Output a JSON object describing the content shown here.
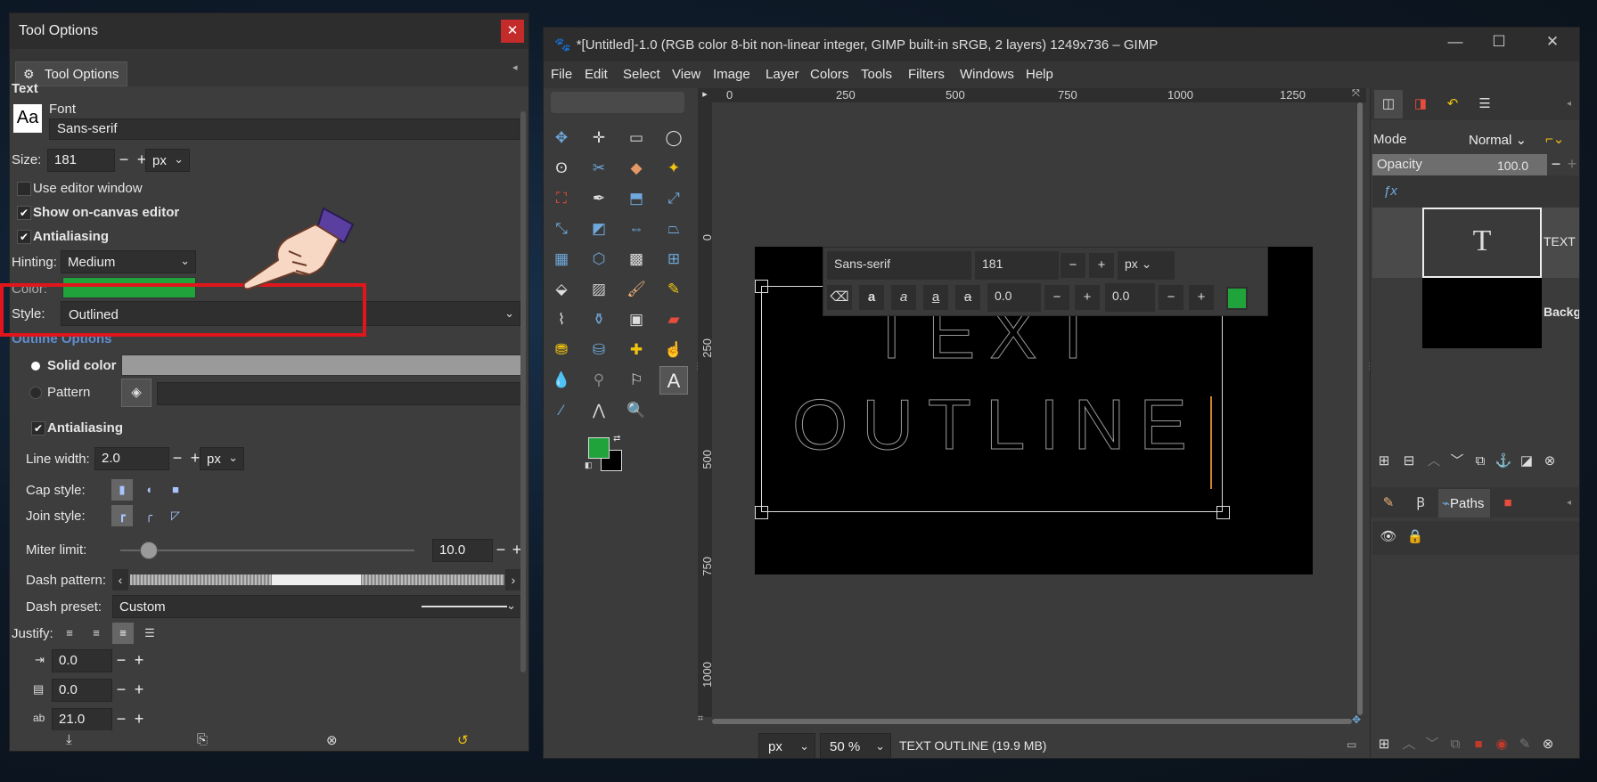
{
  "tool_options": {
    "window_title": "Tool Options",
    "tab_label": "Tool Options",
    "section_text": "Text",
    "font_label": "Font",
    "font_preview": "Aa",
    "font_value": "Sans-serif",
    "size_label": "Size:",
    "size_value": "181",
    "size_unit": "px",
    "use_editor_window": "Use editor window",
    "show_on_canvas": "Show on-canvas editor",
    "antialiasing": "Antialiasing",
    "hinting_label": "Hinting:",
    "hinting_value": "Medium",
    "color_label": "Color:",
    "color_value": "#1fa33a",
    "style_label": "Style:",
    "style_value": "Outlined",
    "outline_options": "Outline Options",
    "solid_color": "Solid color",
    "pattern": "Pattern",
    "outline_antialiasing": "Antialiasing",
    "line_width_label": "Line width:",
    "line_width_value": "2.0",
    "line_width_unit": "px",
    "cap_style": "Cap style:",
    "join_style": "Join style:",
    "miter_limit": "Miter limit:",
    "miter_value": "10.0",
    "dash_pattern": "Dash pattern:",
    "dash_preset_label": "Dash preset:",
    "dash_preset_value": "Custom",
    "justify": "Justify:",
    "indent_value": "0.0",
    "line_spacing_value": "0.0",
    "letter_spacing_value": "21.0"
  },
  "gimp": {
    "title": "*[Untitled]-1.0 (RGB color 8-bit non-linear integer, GIMP built-in sRGB, 2 layers) 1249x736 – GIMP",
    "menu": [
      "File",
      "Edit",
      "Select",
      "View",
      "Image",
      "Layer",
      "Colors",
      "Tools",
      "Filters",
      "Windows",
      "Help"
    ],
    "ruler_h": [
      "0",
      "250",
      "500",
      "750",
      "1000",
      "1250"
    ],
    "ruler_v": [
      "0",
      "250",
      "500",
      "750",
      "1000"
    ],
    "canvas_text_line1": "TEXT",
    "canvas_text_line2": "OUTLINE",
    "text_toolbar": {
      "font": "Sans-serif",
      "size": "181",
      "unit": "px",
      "baseline": "0.0",
      "kerning": "0.0",
      "color": "#1fa33a"
    },
    "status_unit": "px",
    "zoom": "50 %",
    "status_text": "TEXT OUTLINE (19.9 MB)",
    "fg_color": "#1fa33a",
    "bg_color": "#000000"
  },
  "layers_panel": {
    "mode_label": "Mode",
    "mode_value": "Normal",
    "opacity_label": "Opacity",
    "opacity_value": "100.0",
    "layers": [
      {
        "name": "TEXT OUTLINE"
      },
      {
        "name": "Background"
      }
    ],
    "paths_tab": "Paths"
  }
}
